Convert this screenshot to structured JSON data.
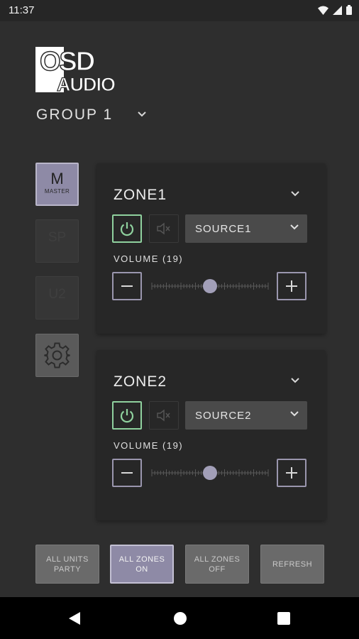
{
  "status_bar": {
    "time": "11:37"
  },
  "brand": {
    "logo_line1": "OSD",
    "logo_line2": "AUDIO"
  },
  "group": {
    "label": "GROUP 1"
  },
  "side": {
    "master_big": "M",
    "master_small": "MASTER",
    "dim1": "SP",
    "dim2": "U2"
  },
  "zones": [
    {
      "title": "ZONE1",
      "source": "SOURCE1",
      "volume_label": "VOLUME (19)",
      "volume_fraction": 0.5,
      "power": "on",
      "muted": false
    },
    {
      "title": "ZONE2",
      "source": "SOURCE2",
      "volume_label": "VOLUME (19)",
      "volume_fraction": 0.5,
      "power": "on",
      "muted": false
    }
  ],
  "bottom": {
    "party": "ALL UNITS PARTY",
    "zones_on": "ALL ZONES ON",
    "zones_off": "ALL ZONES OFF",
    "refresh": "REFRESH"
  },
  "colors": {
    "accent": "#8e8aa6",
    "power_on": "#8fd19e",
    "card_bg": "#272727",
    "page_bg": "#2e2e2e"
  }
}
